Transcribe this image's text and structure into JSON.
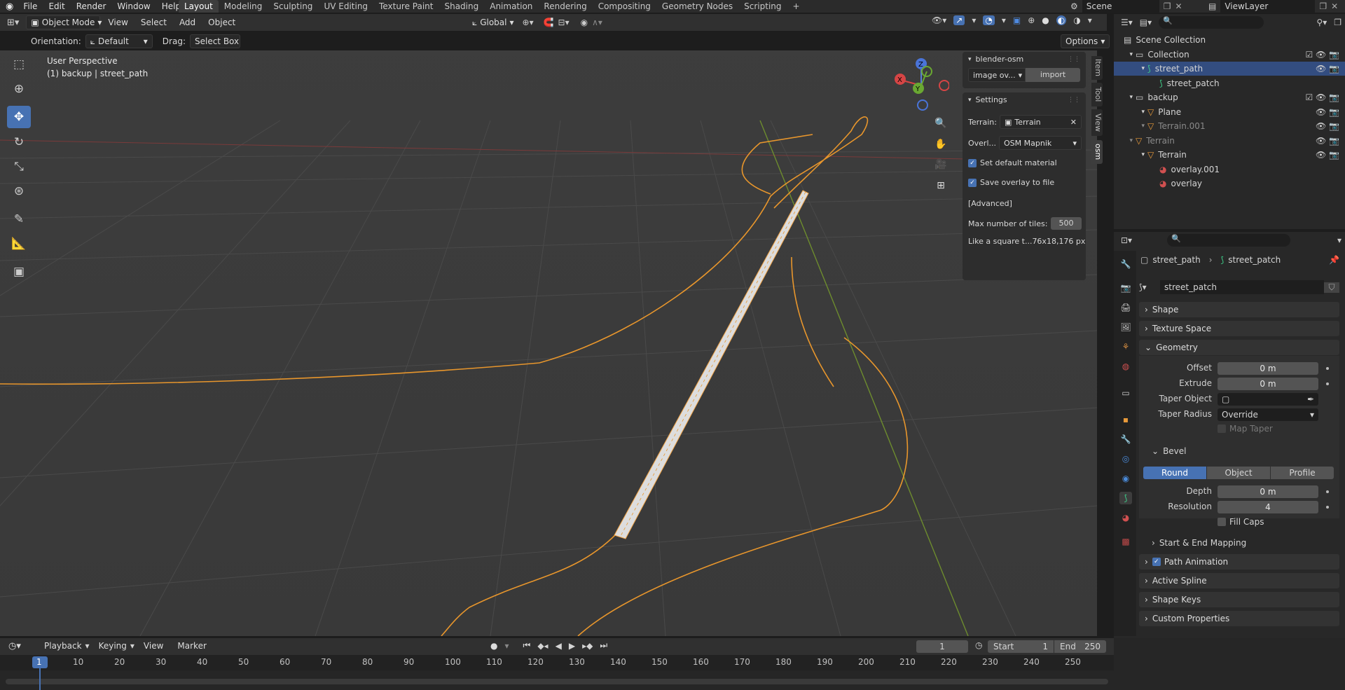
{
  "top_menu": {
    "items": [
      "File",
      "Edit",
      "Render",
      "Window",
      "Help"
    ],
    "workspaces": [
      "Layout",
      "Modeling",
      "Sculpting",
      "UV Editing",
      "Texture Paint",
      "Shading",
      "Animation",
      "Rendering",
      "Compositing",
      "Geometry Nodes",
      "Scripting"
    ],
    "active_workspace": "Layout",
    "add_workspace": "+",
    "scene": "Scene",
    "view_layer": "ViewLayer"
  },
  "viewport_header": {
    "mode": "Object Mode",
    "menus": [
      "View",
      "Select",
      "Add",
      "Object"
    ],
    "transform_orientation": "Global",
    "orientation_label": "Orientation:",
    "orientation_value": "Default",
    "drag_label": "Drag:",
    "drag_value": "Select Box",
    "options": "Options"
  },
  "viewport": {
    "perspective": "User Perspective",
    "object_info": "(1) backup | street_path",
    "gizmo": {
      "x": "X",
      "y": "Y",
      "z": "Z"
    }
  },
  "n_panel": {
    "addon_title": "blender-osm",
    "source_dropdown": "image ov...",
    "import_button": "import",
    "settings_title": "Settings",
    "terrain_label": "Terrain:",
    "terrain_value": "Terrain",
    "overlay_label": "Overl...",
    "overlay_value": "OSM Mapnik",
    "set_default_material": "Set default material",
    "save_overlay": "Save overlay to file",
    "advanced": "[Advanced]",
    "max_tiles_label": "Max number of tiles:",
    "max_tiles_value": "500",
    "square_note": "Like a square t...76x18,176 px",
    "tabs": [
      "Item",
      "Tool",
      "View",
      "osm"
    ]
  },
  "outliner": {
    "rows": [
      {
        "label": "Scene Collection",
        "indent": 0
      },
      {
        "label": "Collection",
        "indent": 1
      },
      {
        "label": "street_path",
        "indent": 2,
        "selected": true
      },
      {
        "label": "street_patch",
        "indent": 3
      },
      {
        "label": "backup",
        "indent": 1
      },
      {
        "label": "Plane",
        "indent": 2
      },
      {
        "label": "Terrain.001",
        "indent": 2,
        "dim": true
      },
      {
        "label": "Terrain",
        "indent": 1,
        "dim": true
      },
      {
        "label": "Terrain",
        "indent": 2
      },
      {
        "label": "overlay.001",
        "indent": 3
      },
      {
        "label": "overlay",
        "indent": 3
      }
    ]
  },
  "properties": {
    "breadcrumb_object": "street_path",
    "breadcrumb_data": "street_patch",
    "datablock": "street_patch",
    "shape": "Shape",
    "texture_space": "Texture Space",
    "geometry": "Geometry",
    "offset_label": "Offset",
    "offset_value": "0 m",
    "extrude_label": "Extrude",
    "extrude_value": "0 m",
    "taper_object_label": "Taper Object",
    "taper_radius_label": "Taper Radius",
    "taper_radius_value": "Override",
    "map_taper": "Map Taper",
    "bevel": "Bevel",
    "bevel_modes": [
      "Round",
      "Object",
      "Profile"
    ],
    "bevel_active": "Round",
    "depth_label": "Depth",
    "depth_value": "0 m",
    "resolution_label": "Resolution",
    "resolution_value": "4",
    "fill_caps": "Fill Caps",
    "start_end_mapping": "Start & End Mapping",
    "path_animation": "Path Animation",
    "active_spline": "Active Spline",
    "shape_keys": "Shape Keys",
    "custom_properties": "Custom Properties"
  },
  "timeline": {
    "menus": [
      "Playback",
      "Keying",
      "View",
      "Marker"
    ],
    "current_frame": "1",
    "start_label": "Start",
    "start_value": "1",
    "end_label": "End",
    "end_value": "250",
    "ruler": [
      "1",
      "10",
      "20",
      "30",
      "40",
      "50",
      "60",
      "70",
      "80",
      "90",
      "100",
      "110",
      "120",
      "130",
      "140",
      "150",
      "160",
      "170",
      "180",
      "190",
      "200",
      "210",
      "220",
      "230",
      "240",
      "250"
    ]
  },
  "colors": {
    "accent": "#4772b3",
    "curve": "#e8962c",
    "selected_row": "#334d80"
  }
}
